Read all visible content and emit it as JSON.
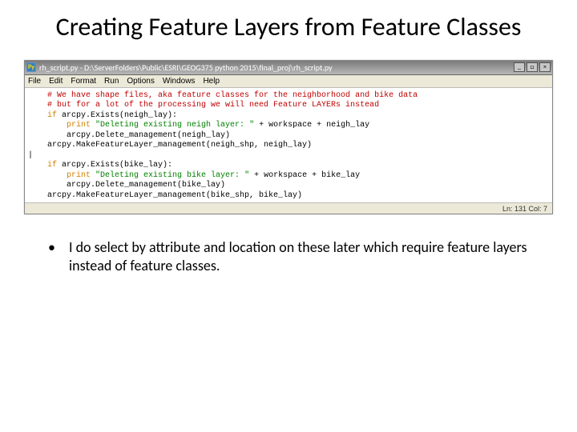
{
  "title": "Creating Feature Layers from Feature Classes",
  "ide": {
    "titlebar_icon_text": "Py",
    "titlebar_text": "rh_script.py - D:\\ServerFolders\\Public\\ESRI\\GEOG375 python 2015\\final_proj\\rh_script.py",
    "menubar": {
      "file": "File",
      "edit": "Edit",
      "format": "Format",
      "run": "Run",
      "options": "Options",
      "windows": "Windows",
      "help": "Help"
    },
    "code": {
      "c1": "# We have shape files, aka feature classes for the neighborhood and bike data",
      "c2": "# but for a lot of the processing we will need Feature LAYERs instead",
      "if1": "if",
      "l3": " arcpy.Exists(neigh_lay):",
      "pr1": "print",
      "s1": " \"Deleting existing neigh layer: \"",
      "l4b": " + workspace + neigh_lay",
      "l5": "    arcpy.Delete_management(neigh_lay)",
      "l6": "arcpy.MakeFeatureLayer_management(neigh_shp, neigh_lay)",
      "if2": "if",
      "l8": " arcpy.Exists(bike_lay):",
      "pr2": "print",
      "s2": " \"Deleting existing bike layer: \"",
      "l9b": " + workspace + bike_lay",
      "l10": "    arcpy.Delete_management(bike_lay)",
      "l11": "arcpy.MakeFeatureLayer_management(bike_shp, bike_lay)"
    },
    "status": "Ln: 131 Col: 7"
  },
  "bullet": {
    "dot": "•",
    "text": "I do select by attribute and location on these later which require feature layers instead of feature classes."
  }
}
